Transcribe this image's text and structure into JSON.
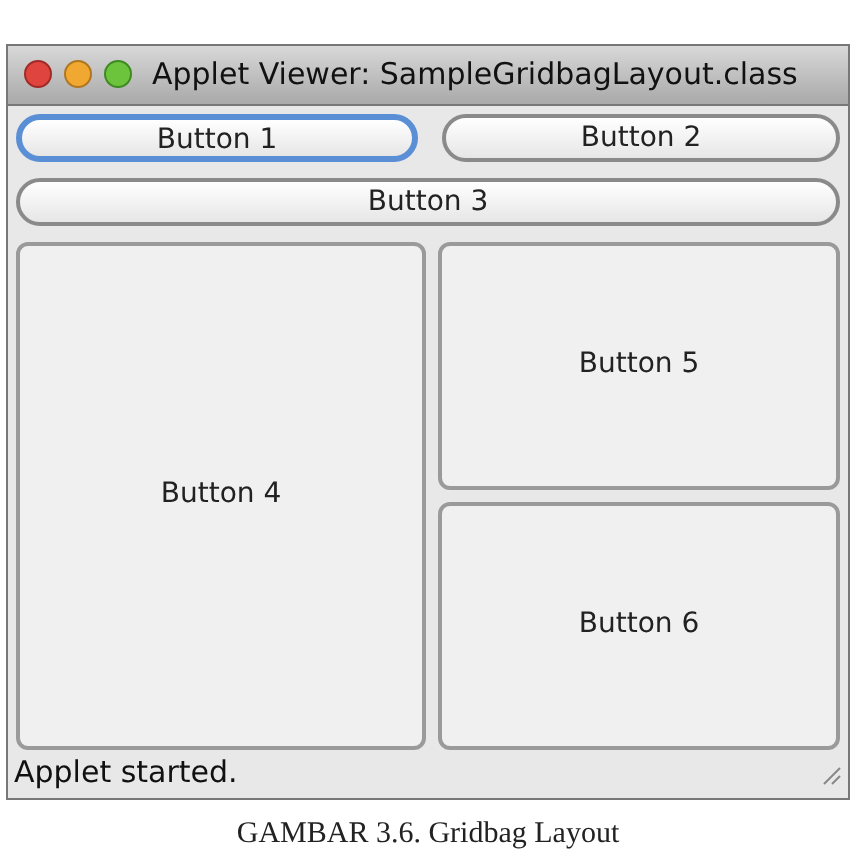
{
  "window": {
    "title": "Applet Viewer: SampleGridbagLayout.class"
  },
  "buttons": [
    {
      "label": "Button 1",
      "focused": true
    },
    {
      "label": "Button 2",
      "focused": false
    },
    {
      "label": "Button 3",
      "focused": false
    },
    {
      "label": "Button 4",
      "focused": false
    },
    {
      "label": "Button 5",
      "focused": false
    },
    {
      "label": "Button 6",
      "focused": false
    }
  ],
  "status_bar": "Applet started.",
  "caption": "GAMBAR 3.6. Gridbag Layout"
}
